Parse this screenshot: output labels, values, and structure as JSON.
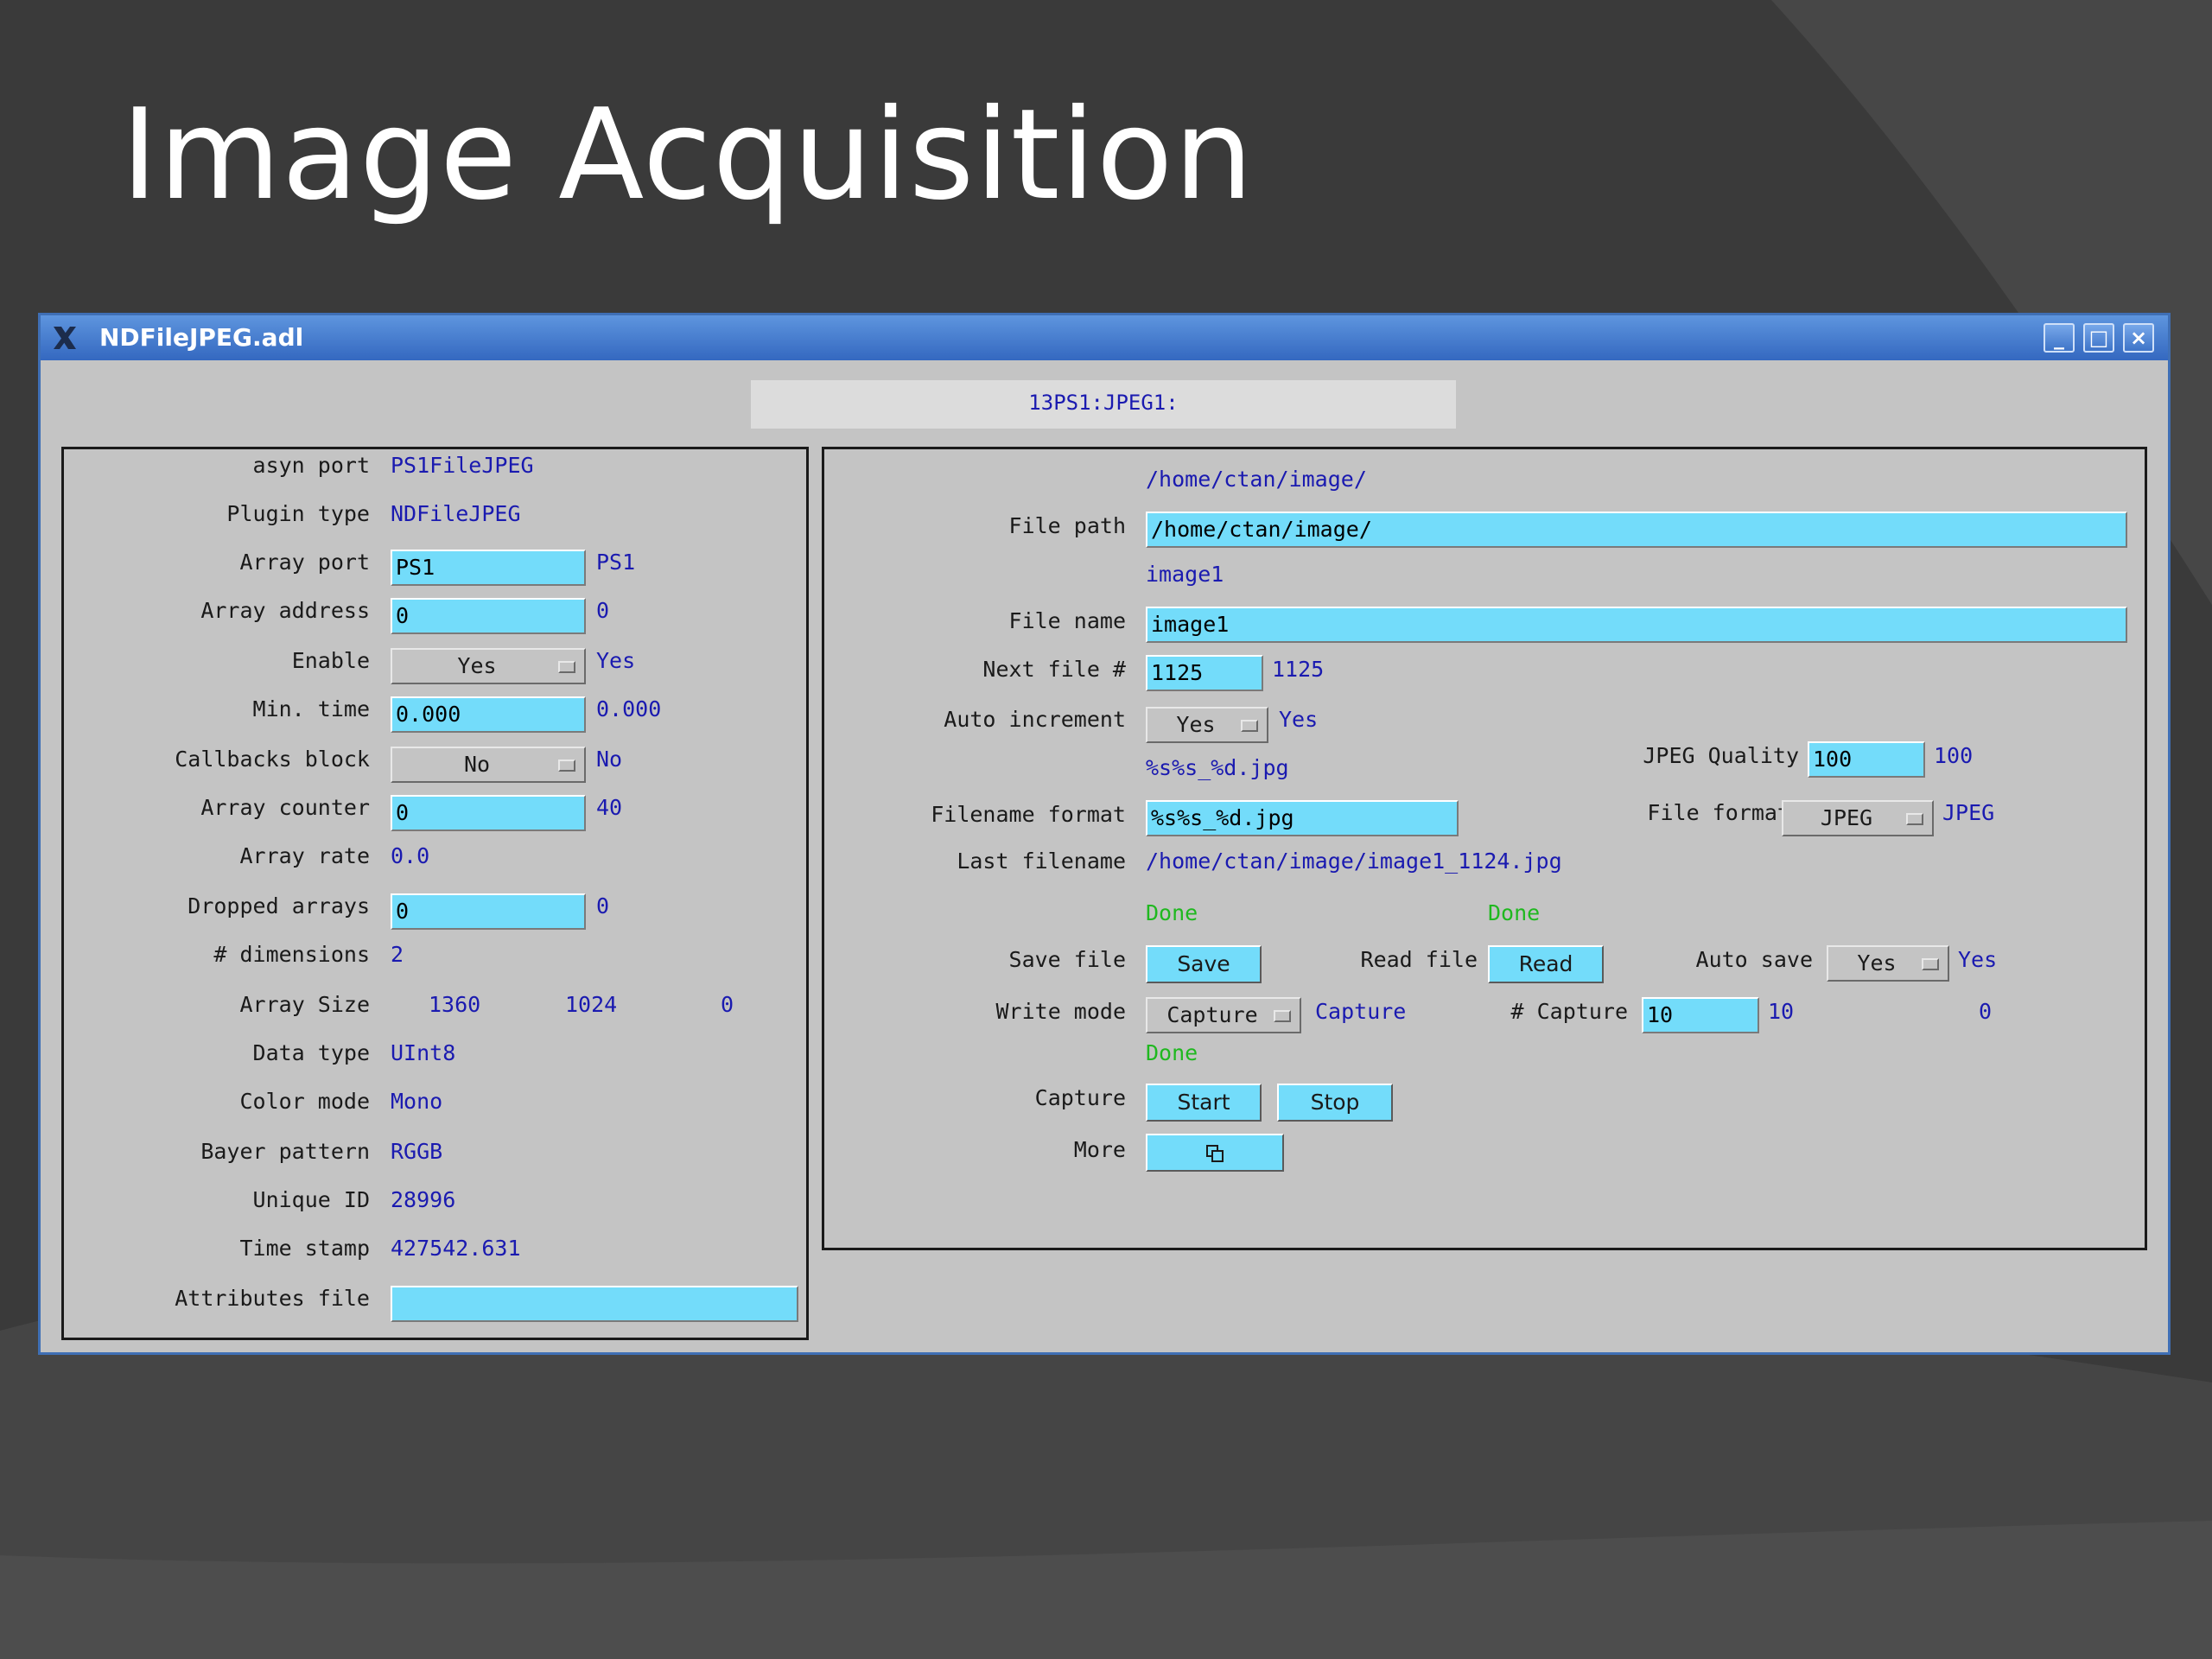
{
  "slide": {
    "title": "Image Acquisition"
  },
  "window": {
    "title": "NDFileJPEG.adl",
    "controls": {
      "minimize": "minimize-icon",
      "maximize": "maximize-icon",
      "close": "close-icon"
    },
    "prefix": "13PS1:JPEG1:"
  },
  "left": {
    "asyn_port": {
      "label": "asyn port",
      "value": "PS1FileJPEG"
    },
    "plugin_type": {
      "label": "Plugin type",
      "value": "NDFileJPEG"
    },
    "array_port": {
      "label": "Array port",
      "input": "PS1",
      "readback": "PS1"
    },
    "array_address": {
      "label": "Array address",
      "input": "0",
      "readback": "0"
    },
    "enable": {
      "label": "Enable",
      "menu": "Yes",
      "readback": "Yes"
    },
    "min_time": {
      "label": "Min. time",
      "input": "0.000",
      "readback": "0.000"
    },
    "callbacks_block": {
      "label": "Callbacks block",
      "menu": "No",
      "readback": "No"
    },
    "array_counter": {
      "label": "Array counter",
      "input": "0",
      "readback": "40"
    },
    "array_rate": {
      "label": "Array rate",
      "value": "0.0"
    },
    "dropped_arrays": {
      "label": "Dropped arrays",
      "input": "0",
      "readback": "0"
    },
    "dimensions": {
      "label": "# dimensions",
      "value": "2"
    },
    "array_size": {
      "label": "Array Size",
      "x": "1360",
      "y": "1024",
      "z": "0"
    },
    "data_type": {
      "label": "Data type",
      "value": "UInt8"
    },
    "color_mode": {
      "label": "Color mode",
      "value": "Mono"
    },
    "bayer_pattern": {
      "label": "Bayer pattern",
      "value": "RGGB"
    },
    "unique_id": {
      "label": "Unique ID",
      "value": "28996"
    },
    "time_stamp": {
      "label": "Time stamp",
      "value": "427542.631"
    },
    "attributes_file": {
      "label": "Attributes file",
      "input": ""
    }
  },
  "right": {
    "file_path": {
      "label": "File path",
      "readback": "/home/ctan/image/",
      "input": "/home/ctan/image/"
    },
    "file_name": {
      "label": "File name",
      "readback": "image1",
      "input": "image1"
    },
    "next_file": {
      "label": "Next file #",
      "input": "1125",
      "readback": "1125"
    },
    "auto_increment": {
      "label": "Auto increment",
      "menu": "Yes",
      "readback": "Yes"
    },
    "jpeg_quality": {
      "label": "JPEG Quality",
      "input": "100",
      "readback": "100"
    },
    "filename_format": {
      "label": "Filename format",
      "readback": "%s%s_%d.jpg",
      "input": "%s%s_%d.jpg"
    },
    "file_format": {
      "label": "File format",
      "menu": "JPEG",
      "readback": "JPEG"
    },
    "last_filename": {
      "label": "Last filename",
      "value": "/home/ctan/image/image1_1124.jpg"
    },
    "save_file": {
      "label": "Save file",
      "status": "Done",
      "button": "Save"
    },
    "read_file": {
      "label": "Read file",
      "status": "Done",
      "button": "Read"
    },
    "auto_save": {
      "label": "Auto save",
      "menu": "Yes",
      "readback": "Yes"
    },
    "write_mode": {
      "label": "Write mode",
      "menu": "Capture",
      "readback": "Capture"
    },
    "num_capture": {
      "label": "# Capture",
      "input": "10",
      "readback": "10",
      "captured": "0"
    },
    "capture": {
      "label": "Capture",
      "status": "Done",
      "start": "Start",
      "stop": "Stop"
    },
    "more": {
      "label": "More",
      "icon": "related-display-icon"
    }
  },
  "colors": {
    "field": "#73dcfa",
    "readback": "#1a1ab0",
    "status_ok": "#1fb81f",
    "panel": "#c4c4c4",
    "titlebar": "#4a80d0"
  }
}
